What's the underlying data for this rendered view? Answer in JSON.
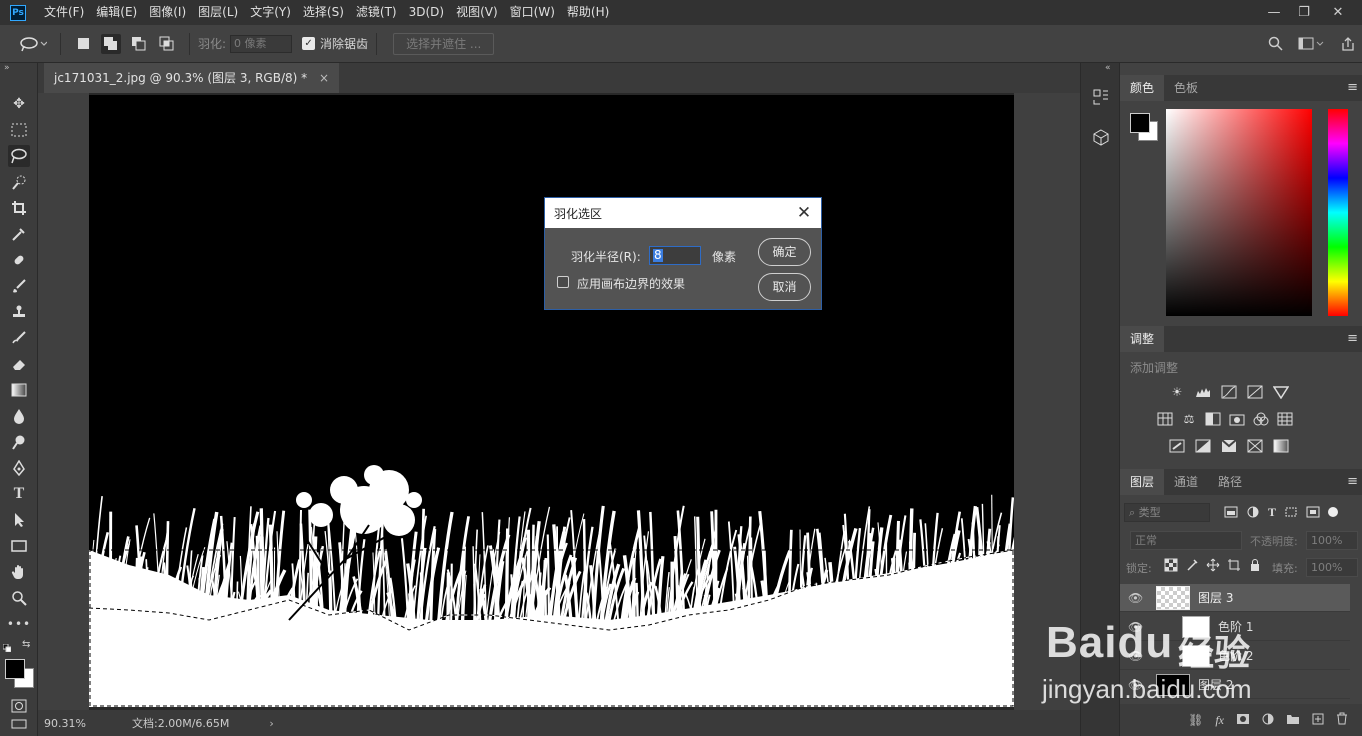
{
  "app": {
    "logo": "Ps"
  },
  "menubar": {
    "items": [
      "文件(F)",
      "编辑(E)",
      "图像(I)",
      "图层(L)",
      "文字(Y)",
      "选择(S)",
      "滤镜(T)",
      "3D(D)",
      "视图(V)",
      "窗口(W)",
      "帮助(H)"
    ],
    "minimize": "—",
    "restore": "❐",
    "close": "✕"
  },
  "options": {
    "feather_label": "羽化:",
    "feather_value": "0 像素",
    "antialias_checked": true,
    "antialias_label": "消除锯齿",
    "select_mask_label": "选择并遮住 ..."
  },
  "document": {
    "tab_title": "jc171031_2.jpg @ 90.3% (图层 3, RGB/8) *",
    "tab_close": "×",
    "zoom": "90.31%",
    "doc_info": "文档:2.00M/6.65M",
    "status_arrow": "›"
  },
  "dialog": {
    "title": "羽化选区",
    "close": "✕",
    "radius_label": "羽化半径(R):",
    "radius_value": "8",
    "unit": "像素",
    "apply_canvas_label": "应用画布边界的效果",
    "apply_canvas_checked": false,
    "ok": "确定",
    "cancel": "取消"
  },
  "color_panel": {
    "tabs": [
      "颜色",
      "色板"
    ],
    "active_tab": "颜色",
    "foreground": "#000000",
    "background": "#ffffff",
    "hue": "#ff0000"
  },
  "adjustments_panel": {
    "tab": "调整",
    "add_label": "添加调整"
  },
  "layers_panel": {
    "tabs": [
      "图层",
      "通道",
      "路径"
    ],
    "active_tab": "图层",
    "filter_label": "类型",
    "blend_mode": "正常",
    "opacity_label": "不透明度:",
    "opacity_value": "100%",
    "lock_label": "锁定:",
    "fill_label": "填充:",
    "fill_value": "100%",
    "layers": [
      {
        "name": "图层 3"
      },
      {
        "name": "色阶 1"
      },
      {
        "name": "色阶 2"
      },
      {
        "name": "图层 2"
      }
    ]
  },
  "watermark": {
    "brand": "Baidu",
    "brand_cn": "经验",
    "url": "jingyan.baidu.com"
  },
  "icons": {
    "menu": "≡",
    "eye": "👁",
    "collapse": "»"
  }
}
